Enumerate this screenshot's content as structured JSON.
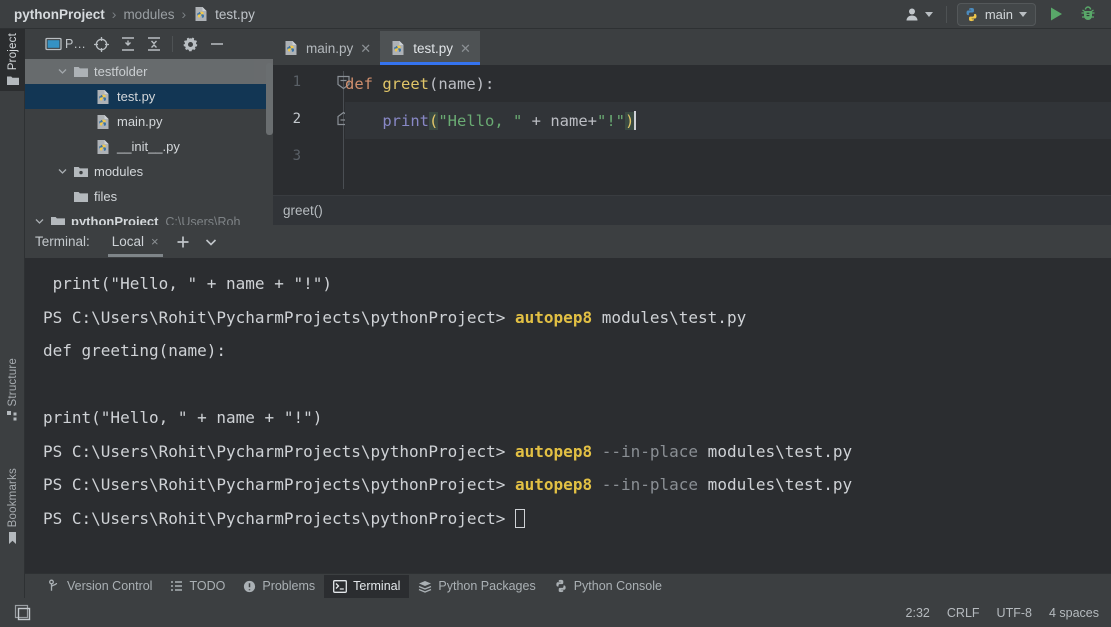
{
  "topbar": {
    "breadcrumb": [
      {
        "text": "pythonProject",
        "style": "bold"
      },
      {
        "text": "modules",
        "style": "dim"
      },
      {
        "text": "test.py",
        "style": "normal",
        "icon": "python-file-icon"
      }
    ],
    "separator": "›",
    "user_icon": "user-account-icon",
    "run_config": {
      "label": "main",
      "icon": "python-icon"
    },
    "run_button": "run-icon",
    "debug_button": "debug-icon"
  },
  "left_tool_strip": [
    {
      "label": "Project",
      "icon": "folder-icon",
      "active": true
    },
    {
      "label": "Structure",
      "icon": "structure-icon",
      "active": false
    },
    {
      "label": "Bookmarks",
      "icon": "bookmark-icon",
      "active": false
    }
  ],
  "project_panel": {
    "toolbar": [
      {
        "name": "project-view-selector",
        "label": "P…",
        "icon": "window-icon"
      },
      {
        "name": "scroll-from-source",
        "icon": "target-icon"
      },
      {
        "name": "expand-all",
        "icon": "expand-all-icon"
      },
      {
        "name": "collapse-all",
        "icon": "collapse-all-icon"
      },
      {
        "name": "settings",
        "icon": "gear-icon"
      },
      {
        "name": "hide",
        "icon": "minus-icon"
      }
    ],
    "tree": [
      {
        "label": "pythonProject",
        "path": "C:\\Users\\Roh",
        "icon": "folder-icon",
        "arrow": "expanded",
        "indent": 0,
        "bold": true,
        "selected": false
      },
      {
        "label": "files",
        "path": "",
        "icon": "folder-icon",
        "arrow": "none",
        "indent": 1,
        "bold": false,
        "selected": false
      },
      {
        "label": "modules",
        "path": "",
        "icon": "package-folder-icon",
        "arrow": "expanded",
        "indent": 1,
        "bold": false,
        "selected": false
      },
      {
        "label": "__init__.py",
        "path": "",
        "icon": "python-file-icon",
        "arrow": "none",
        "indent": 2,
        "bold": false,
        "selected": false
      },
      {
        "label": "main.py",
        "path": "",
        "icon": "python-file-icon",
        "arrow": "none",
        "indent": 2,
        "bold": false,
        "selected": false
      },
      {
        "label": "test.py",
        "path": "",
        "icon": "python-file-icon",
        "arrow": "none",
        "indent": 2,
        "bold": false,
        "selected": true
      },
      {
        "label": "testfolder",
        "path": "",
        "icon": "folder-icon",
        "arrow": "expanded",
        "indent": 1,
        "bold": false,
        "selected": false
      }
    ]
  },
  "editor": {
    "tabs": [
      {
        "label": "main.py",
        "icon": "python-file-icon",
        "active": false
      },
      {
        "label": "test.py",
        "icon": "python-file-icon",
        "active": true
      }
    ],
    "line_numbers": [
      "1",
      "2",
      "3"
    ],
    "current_line": 2,
    "code_lines": [
      {
        "n": 1,
        "tokens": [
          {
            "t": "def",
            "c": "k-def"
          },
          {
            "t": " ",
            "c": "k-plain"
          },
          {
            "t": "greet",
            "c": "k-fn"
          },
          {
            "t": "(name):",
            "c": "k-plain"
          }
        ]
      },
      {
        "n": 2,
        "tokens": [
          {
            "t": "    ",
            "c": "k-plain"
          },
          {
            "t": "print",
            "c": "k-builtin"
          },
          {
            "t": "(",
            "c": "k-paren-hl"
          },
          {
            "t": "\"Hello, \"",
            "c": "k-str"
          },
          {
            "t": " + name+",
            "c": "k-plain"
          },
          {
            "t": "\"!\"",
            "c": "k-str"
          },
          {
            "t": ")",
            "c": "k-paren-hl"
          }
        ]
      },
      {
        "n": 3,
        "tokens": []
      }
    ],
    "breadcrumb": "greet()"
  },
  "terminal": {
    "title": "Terminal:",
    "tab": {
      "label": "Local",
      "close": "×"
    },
    "add_icon": "plus-icon",
    "more_icon": "chevron-down-icon",
    "lines": [
      [
        {
          "t": " print(\"Hello, \" + name + \"!\")",
          "c": "plain"
        }
      ],
      [
        {
          "t": "PS C:\\Users\\Rohit\\PycharmProjects\\pythonProject> ",
          "c": "plain"
        },
        {
          "t": "autopep8",
          "c": "cmd"
        },
        {
          "t": " modules\\test.py",
          "c": "plain"
        }
      ],
      [
        {
          "t": "def greeting(name):",
          "c": "plain"
        }
      ],
      [],
      [
        {
          "t": "print(\"Hello, \" + name + \"!\")",
          "c": "plain"
        }
      ],
      [
        {
          "t": "PS C:\\Users\\Rohit\\PycharmProjects\\pythonProject> ",
          "c": "plain"
        },
        {
          "t": "autopep8",
          "c": "cmd"
        },
        {
          "t": " ",
          "c": "plain"
        },
        {
          "t": "--in-place",
          "c": "flag"
        },
        {
          "t": " modules\\test.py",
          "c": "plain"
        }
      ],
      [
        {
          "t": "PS C:\\Users\\Rohit\\PycharmProjects\\pythonProject> ",
          "c": "plain"
        },
        {
          "t": "autopep8",
          "c": "cmd"
        },
        {
          "t": " ",
          "c": "plain"
        },
        {
          "t": "--in-place",
          "c": "flag"
        },
        {
          "t": " modules\\test.py",
          "c": "plain"
        }
      ],
      [
        {
          "t": "PS C:\\Users\\Rohit\\PycharmProjects\\pythonProject> ",
          "c": "plain"
        },
        {
          "t": "",
          "c": "cursor"
        }
      ]
    ]
  },
  "bottom_bar": [
    {
      "label": "Version Control",
      "icon": "branch-icon",
      "active": false
    },
    {
      "label": "TODO",
      "icon": "list-icon",
      "active": false
    },
    {
      "label": "Problems",
      "icon": "warning-icon",
      "active": false
    },
    {
      "label": "Terminal",
      "icon": "terminal-icon",
      "active": true
    },
    {
      "label": "Python Packages",
      "icon": "packages-icon",
      "active": false
    },
    {
      "label": "Python Console",
      "icon": "python-console-icon",
      "active": false
    }
  ],
  "status_bar": {
    "layout_icon": "layout-icon",
    "caret_position": "2:32",
    "line_separator": "CRLF",
    "encoding": "UTF-8",
    "indent": "4 spaces"
  },
  "colors": {
    "background": "#3c3f41",
    "editor_background": "#2b2d30",
    "selection": "#123654",
    "accent_blue": "#3574f0",
    "keyword_orange": "#cf8e6d",
    "function_yellow": "#e0c568",
    "string_green": "#6aab73",
    "builtin_purple": "#8888c6",
    "terminal_command_yellow": "#e2c044"
  }
}
